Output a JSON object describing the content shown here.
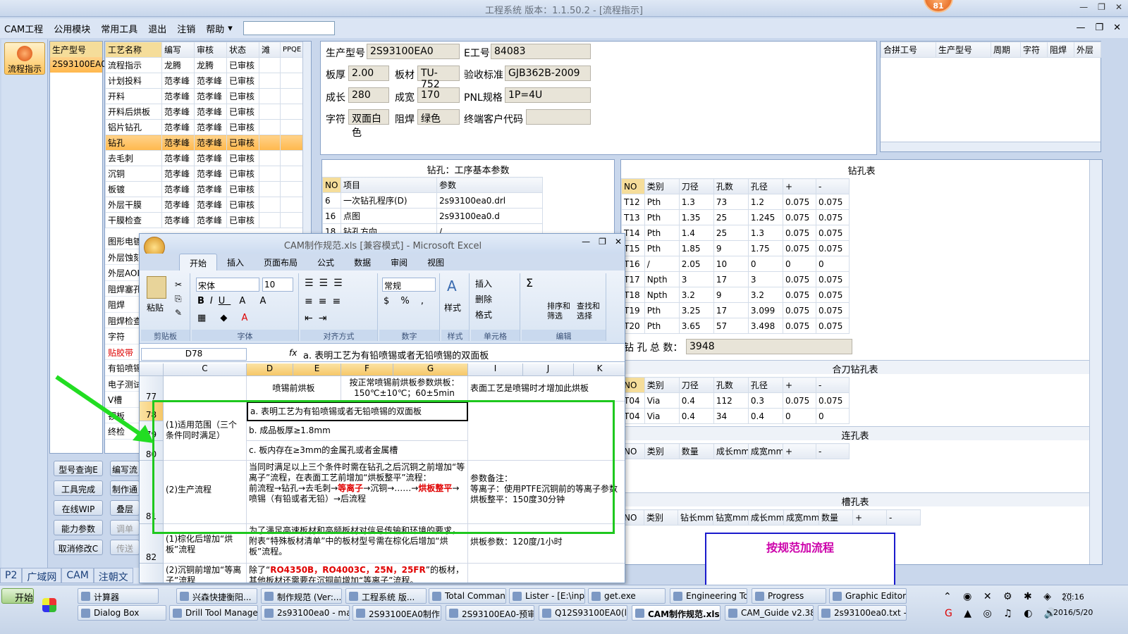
{
  "window_title": "工程系统   版本：1.1.50.2 - [流程指示]",
  "badge": "81",
  "menu": [
    "CAM工程",
    "公用模块",
    "常用工具",
    "退出",
    "注销",
    "帮助"
  ],
  "menu_arrow": "▾",
  "flow_button": "流程指示",
  "model_list": {
    "header": "生产型号",
    "items": [
      "2S93100EA0"
    ]
  },
  "process_table": {
    "headers": [
      "工艺名称",
      "编写",
      "审核",
      "状态",
      "滩",
      "PPQE"
    ],
    "rows": [
      [
        "流程指示",
        "龙腾",
        "龙腾",
        "已审核"
      ],
      [
        "计划投料",
        "范孝峰",
        "范孝峰",
        "已审核"
      ],
      [
        "开料",
        "范孝峰",
        "范孝峰",
        "已审核"
      ],
      [
        "开料后烘板",
        "范孝峰",
        "范孝峰",
        "已审核"
      ],
      [
        "铝片钻孔",
        "范孝峰",
        "范孝峰",
        "已审核"
      ],
      [
        "钻孔",
        "范孝峰",
        "范孝峰",
        "已审核"
      ],
      [
        "去毛刺",
        "范孝峰",
        "范孝峰",
        "已审核"
      ],
      [
        "沉铜",
        "范孝峰",
        "范孝峰",
        "已审核"
      ],
      [
        "板镀",
        "范孝峰",
        "范孝峰",
        "已审核"
      ],
      [
        "外层干膜",
        "范孝峰",
        "范孝峰",
        "已审核"
      ],
      [
        "干膜检查",
        "范孝峰",
        "范孝峰",
        "已审核"
      ]
    ],
    "more": [
      "图形电镀",
      "外层蚀刻",
      "外层AOI",
      "阻焊塞孔",
      "阻焊",
      "阻焊检查",
      "字符",
      "贴胶带",
      "有铅喷锡",
      "电子测试",
      "V槽",
      "锣板",
      "终检"
    ]
  },
  "left_buttons": [
    "型号查询E",
    "编写流",
    "工具完成",
    "制作通",
    "在线WIP",
    "叠层",
    "能力参数",
    "调单",
    "取消修改C",
    "传送"
  ],
  "status_tabs": [
    "P2",
    "广域网",
    "CAM",
    "注朝文"
  ],
  "info": {
    "model_label": "生产型号",
    "model": "2S93100EA0",
    "e_label": "E工号",
    "e_no": "84083",
    "thick_label": "板厚",
    "thick": "2.00",
    "mat_label": "板材",
    "mat": "TU-752",
    "std_label": "验收标准",
    "std": "GJB362B-2009",
    "len_label": "成长",
    "len": "280",
    "wid_label": "成宽",
    "wid": "170",
    "pnl_label": "PNL规格",
    "pnl": "1P=4U",
    "char_label": "字符",
    "char": "双面白色",
    "mask_label": "阻焊",
    "mask": "绿色",
    "cust_label": "终端客户代码",
    "cust": ""
  },
  "combine_headers": [
    "合拼工号",
    "生产型号",
    "周期",
    "字符",
    "阻焊",
    "外层"
  ],
  "drill_params": {
    "title": "钻孔：工序基本参数",
    "headers": [
      "NO",
      "项目",
      "参数"
    ],
    "rows": [
      [
        "6",
        "一次钻孔程序(D)",
        "2s93100ea0.drl"
      ],
      [
        "16",
        "点图",
        "2s93100ea0.d"
      ],
      [
        "18",
        "钻孔方向",
        "/"
      ]
    ]
  },
  "drill_table": {
    "title": "钻孔表",
    "headers": [
      "NO",
      "类别",
      "刀径",
      "孔数",
      "孔径",
      "+",
      "-"
    ],
    "rows": [
      [
        "T12",
        "Pth",
        "1.3",
        "73",
        "1.2",
        "0.075",
        "0.075"
      ],
      [
        "T13",
        "Pth",
        "1.35",
        "25",
        "1.245",
        "0.075",
        "0.075"
      ],
      [
        "T14",
        "Pth",
        "1.4",
        "25",
        "1.3",
        "0.075",
        "0.075"
      ],
      [
        "T15",
        "Pth",
        "1.85",
        "9",
        "1.75",
        "0.075",
        "0.075"
      ],
      [
        "T16",
        "/",
        "2.05",
        "10",
        "0",
        "0",
        "0"
      ],
      [
        "T17",
        "Npth",
        "3",
        "17",
        "3",
        "0.075",
        "0.075"
      ],
      [
        "T18",
        "Npth",
        "3.2",
        "9",
        "3.2",
        "0.075",
        "0.075"
      ],
      [
        "T19",
        "Pth",
        "3.25",
        "17",
        "3.099",
        "0.075",
        "0.075"
      ],
      [
        "T20",
        "Pth",
        "3.65",
        "57",
        "3.498",
        "0.075",
        "0.075"
      ]
    ],
    "total_label": "钻 孔 总 数：",
    "total": "3948"
  },
  "combine_drill": {
    "title": "合刀钻孔表",
    "headers": [
      "NO",
      "类别",
      "刀径",
      "孔数",
      "孔径",
      "+",
      "-"
    ],
    "rows": [
      [
        "T04",
        "Via",
        "0.4",
        "112",
        "0.3",
        "0.075",
        "0.075"
      ],
      [
        "T04",
        "Via",
        "0.4",
        "34",
        "0.4",
        "0",
        "0"
      ]
    ]
  },
  "link_table": {
    "title": "连孔表",
    "headers": [
      "NO",
      "类别",
      "数量",
      "成长mm",
      "成宽mm",
      "+",
      "-"
    ]
  },
  "slot_table": {
    "title": "槽孔表",
    "headers": [
      "NO",
      "类别",
      "钻长mm",
      "钻宽mm",
      "成长mm",
      "成宽mm",
      "数量",
      "+",
      "-"
    ]
  },
  "note_box": "按规范加流程",
  "excel": {
    "title": "CAM制作规范.xls  [兼容模式] - Microsoft Excel",
    "tabs": [
      "开始",
      "插入",
      "页面布局",
      "公式",
      "数据",
      "审阅",
      "视图"
    ],
    "groups": [
      "剪贴板",
      "字体",
      "对齐方式",
      "数字",
      "样式",
      "单元格",
      "编辑"
    ],
    "font": "宋体",
    "size": "10",
    "numfmt": "常规",
    "paste": "粘贴",
    "insert": "插入",
    "delete": "删除",
    "format": "格式",
    "sort": "排序和\n筛选",
    "find": "查找和\n选择",
    "style": "样式",
    "namebox": "D78",
    "fx": "fx",
    "formula": "a. 表明工艺为有铅喷锡或者无铅喷锡的双面板",
    "cols": [
      "C",
      "D",
      "E",
      "F",
      "G",
      "I",
      "J",
      "K"
    ],
    "rows": [
      "77",
      "78",
      "79",
      "80",
      "81",
      "82"
    ],
    "r77_d": "喷锡前烘板",
    "r77_f": "按正常喷锡前烘板参数烘板：150℃±10℃；60±5min",
    "r77_i": "表面工艺是喷锡时才增加此烘板",
    "scope": "(1)适用范围（三个条件同时满足）",
    "a": "a. 表明工艺为有铅喷锡或者无铅喷锡的双面板",
    "b": "b. 成品板厚≥1.8mm",
    "c": "c. 板内存在≥3mm的金属孔或者金属槽",
    "flow": "(2)生产流程",
    "flow_text1": "当同时满足以上三个条件时需在钻孔之后沉铜之前增加“等离子”流程，在表面工艺前增加“烘板整平”流程：",
    "flow_text2a": "前流程→钻孔→去毛刺→",
    "flow_red1": "等离子",
    "flow_text2b": "→沉铜→……→",
    "flow_red2": "烘板整平",
    "flow_text2c": "→喷锡（有铅或者无铅）→后流程",
    "note_i": "参数备注：\n等离子：使用PTFE沉铜前的等离子参数\n烘板整平：150度30分钟",
    "r82_c": "(1)棕化后增加“烘板”流程",
    "r82_d": "为了满足高速板材和高频板材对信号传输和环境的要求，附表“特殊板材清单”中的板材型号需在棕化后增加“烘板”流程。",
    "r82_i": "烘板参数：120度/1小时",
    "r83_c": "(2)沉铜前增加“等离子”流程",
    "r83_d1": "除了“",
    "r83_red": "RO4350B，RO4003C，25N，25FR",
    "r83_d2": "”的板材，其他板材还需要在沉铜前增加“等离子”流程。"
  },
  "taskbar": {
    "start": "开始",
    "row1": [
      "计算器",
      "兴森快捷衡阳...",
      "制作规范 (Ver:...",
      "工程系统  版...",
      "Total Command...",
      "Lister - [E:\\inpu...",
      "get.exe",
      "Engineering To...",
      "Progress",
      "Graphic Editor 9..."
    ],
    "row2": [
      "Dialog Box",
      "Drill Tool Manager",
      "2s93100ea0 - main...",
      "2S93100EA0制作...",
      "2S93100EA0-预审...",
      "Q12S93100EA0(liu...",
      "CAM制作规范.xls...",
      "CAM_Guide v2.38",
      "2s93100ea0.txt - ..."
    ],
    "time": "20:16",
    "date": "2016/5/20"
  },
  "colors": {
    "accent": "#ffb84d",
    "green_box": "#1ec81e",
    "arrow": "#22dd22",
    "note_border": "#1a1acc",
    "note_text": "#cc00aa"
  }
}
